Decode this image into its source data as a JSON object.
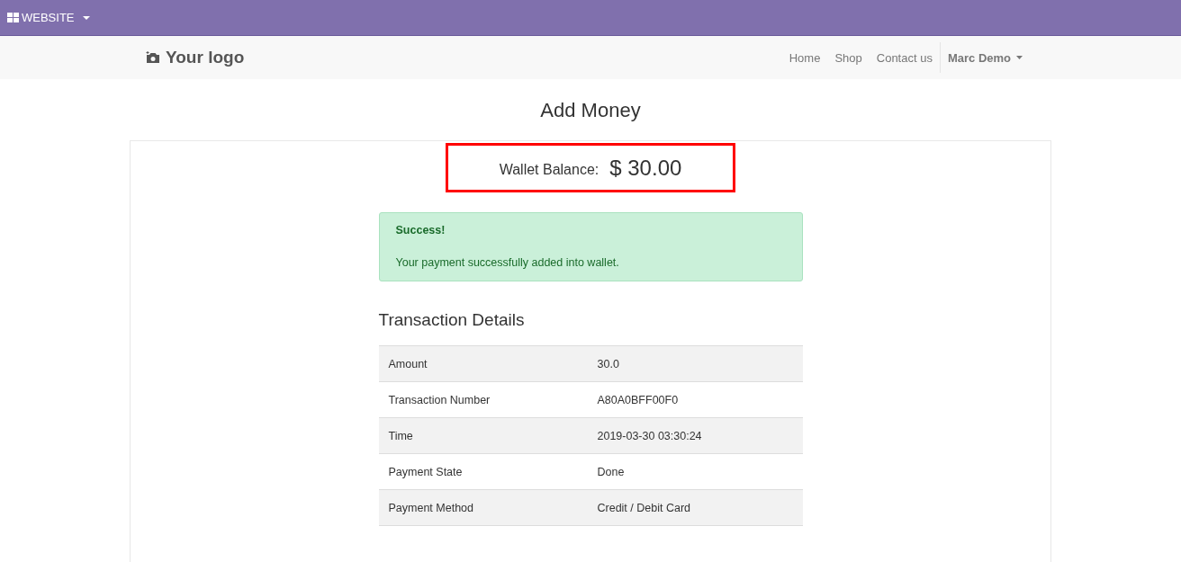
{
  "top_bar": {
    "menu": "WEBSITE"
  },
  "navbar": {
    "logo": "Your logo",
    "links": [
      "Home",
      "Shop",
      "Contact us"
    ],
    "user": "Marc Demo"
  },
  "page_title": "Add Money",
  "wallet": {
    "label": "Wallet Balance:",
    "amount": "$ 30.00"
  },
  "alert": {
    "title": "Success!",
    "message": "Your payment successfully added into wallet."
  },
  "transaction": {
    "heading": "Transaction Details",
    "rows": [
      {
        "label": "Amount",
        "value": "30.0"
      },
      {
        "label": "Transaction Number",
        "value": "A80A0BFF00F0"
      },
      {
        "label": "Time",
        "value": "2019-03-30 03:30:24"
      },
      {
        "label": "Payment State",
        "value": "Done"
      },
      {
        "label": "Payment Method",
        "value": "Credit / Debit Card"
      }
    ]
  }
}
